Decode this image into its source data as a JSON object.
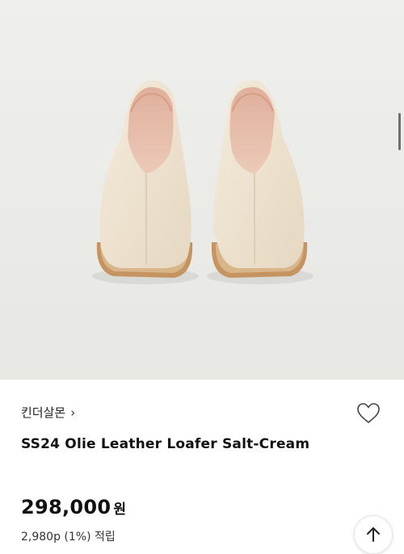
{
  "product": {
    "brand": "킨더살몬",
    "brand_chevron": "›",
    "title": "SS24 Olie Leather Loafer Salt-Cream",
    "price": "298,000",
    "currency": "원",
    "points": "2,980p (1%) 적립"
  },
  "icons": {
    "wishlist": "heart-outline-icon",
    "scroll_top": "arrow-up-icon",
    "brand_link": "chevron-right-icon"
  },
  "colors": {
    "image_bg": "#ececea",
    "shoe_leather": "#efe4d2",
    "sole": "#c4915e",
    "text": "#111111"
  }
}
